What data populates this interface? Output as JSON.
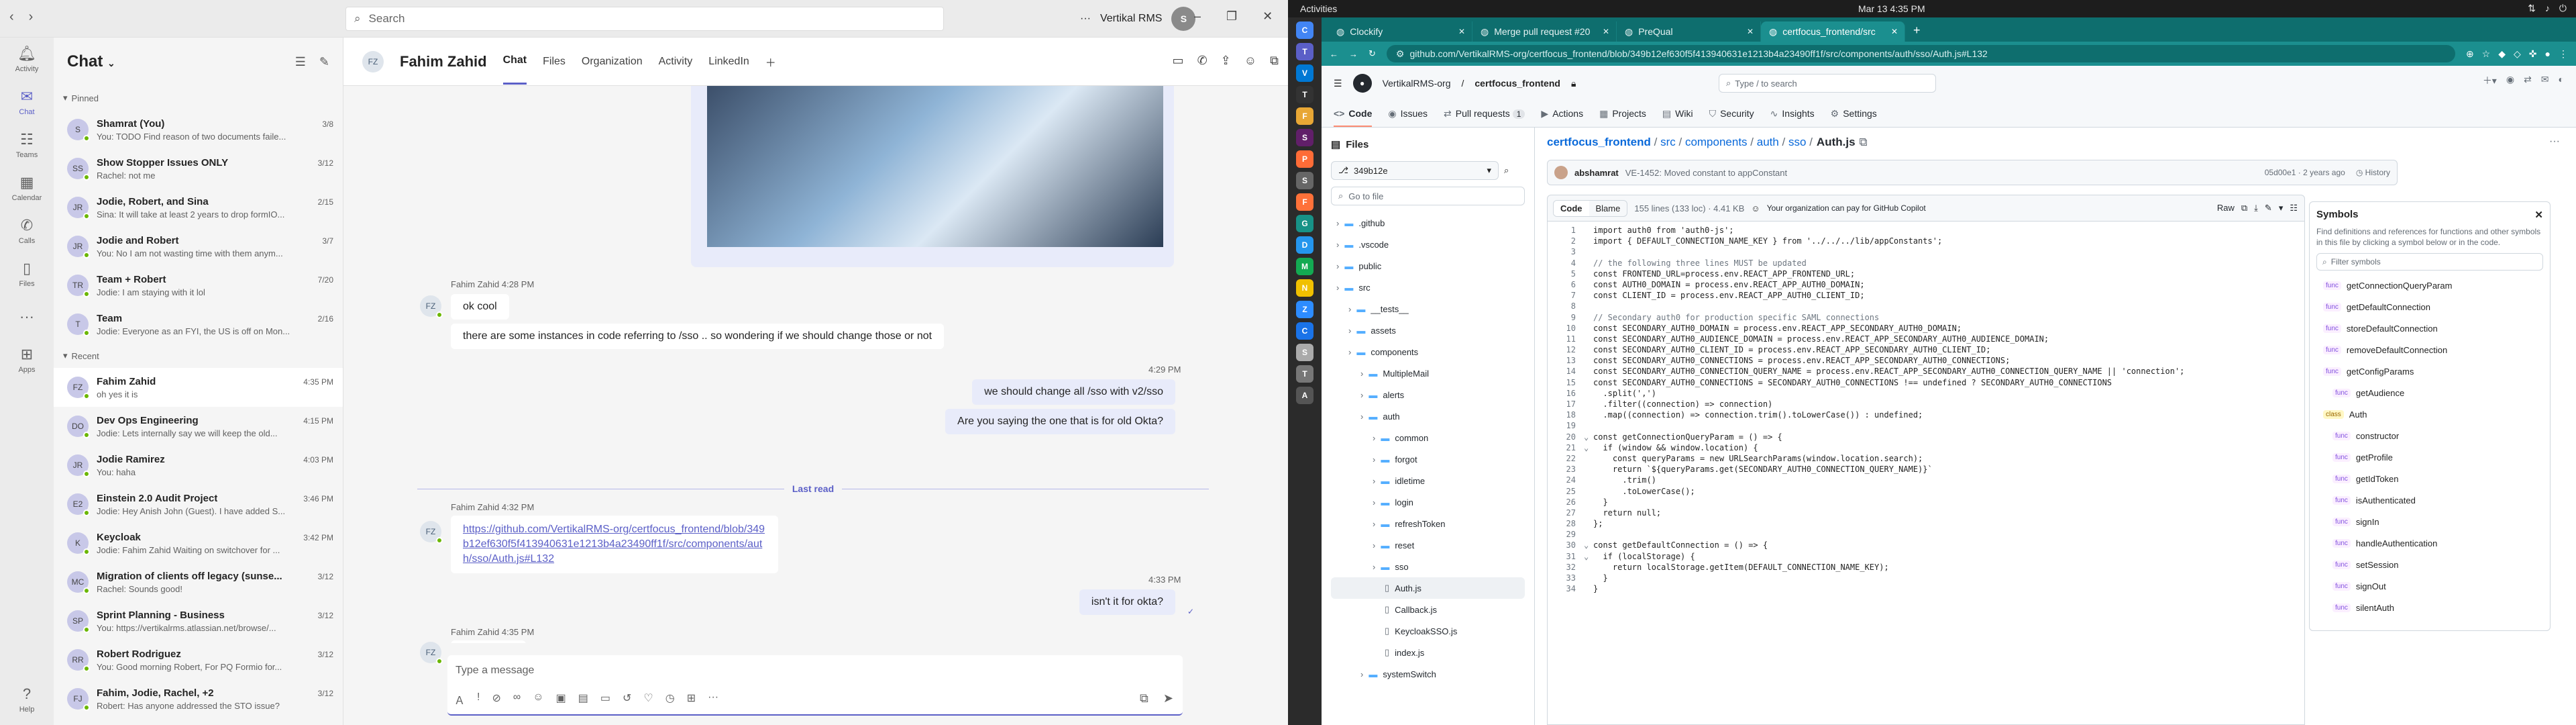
{
  "teams": {
    "search_placeholder": "Search",
    "org_name": "Vertikal RMS",
    "user_initials": "S",
    "rail": [
      {
        "label": "Activity",
        "icon": "bell-icon"
      },
      {
        "label": "Chat",
        "icon": "chat-icon"
      },
      {
        "label": "Teams",
        "icon": "teams-icon"
      },
      {
        "label": "Calendar",
        "icon": "calendar-icon"
      },
      {
        "label": "Calls",
        "icon": "phone-icon"
      },
      {
        "label": "Files",
        "icon": "file-icon"
      },
      {
        "label": "...",
        "icon": "more-icon"
      },
      {
        "label": "Apps",
        "icon": "apps-icon"
      },
      {
        "label": "Help",
        "icon": "help-icon"
      }
    ],
    "chatlist": {
      "title": "Chat",
      "pinned_label": "Pinned",
      "recent_label": "Recent",
      "pinned": [
        {
          "initials": "S",
          "name": "Shamrat (You)",
          "time": "3/8",
          "preview": "You: TODO Find reason of two documents faile..."
        },
        {
          "initials": "SS",
          "name": "Show Stopper Issues ONLY",
          "time": "3/12",
          "preview": "Rachel: not me"
        },
        {
          "initials": "JR",
          "name": "Jodie, Robert, and Sina",
          "time": "2/15",
          "preview": "Sina: It will take at least 2 years to drop formIO..."
        },
        {
          "initials": "JR",
          "name": "Jodie and Robert",
          "time": "3/7",
          "preview": "You: No I am not wasting time with them anym..."
        },
        {
          "initials": "TR",
          "name": "Team + Robert",
          "time": "7/20",
          "preview": "Jodie: I am staying with it lol"
        },
        {
          "initials": "T",
          "name": "Team",
          "time": "2/16",
          "preview": "Jodie: Everyone as an FYI, the US is off on Mon..."
        }
      ],
      "recent": [
        {
          "initials": "FZ",
          "name": "Fahim Zahid",
          "time": "4:35 PM",
          "preview": "oh yes it is"
        },
        {
          "initials": "DO",
          "name": "Dev Ops Engineering",
          "time": "4:15 PM",
          "preview": "Jodie: Lets internally say we will keep the old..."
        },
        {
          "initials": "JR",
          "name": "Jodie Ramirez",
          "time": "4:03 PM",
          "preview": "You: haha"
        },
        {
          "initials": "E2",
          "name": "Einstein 2.0 Audit Project",
          "time": "3:46 PM",
          "preview": "Jodie: Hey Anish John (Guest). I have added S..."
        },
        {
          "initials": "K",
          "name": "Keycloak",
          "time": "3:42 PM",
          "preview": "Jodie: Fahim Zahid Waiting on switchover for ..."
        },
        {
          "initials": "MC",
          "name": "Migration of clients off legacy (sunse...",
          "time": "3/12",
          "preview": "Rachel: Sounds good!"
        },
        {
          "initials": "SP",
          "name": "Sprint Planning - Business",
          "time": "3/12",
          "preview": "You: https://vertikalrms.atlassian.net/browse/..."
        },
        {
          "initials": "RR",
          "name": "Robert Rodriguez",
          "time": "3/12",
          "preview": "You: Good morning Robert, For PQ Formio for..."
        },
        {
          "initials": "FJ",
          "name": "Fahim, Jodie, Rachel, +2",
          "time": "3/12",
          "preview": "Robert: Has anyone addressed the STO issue?"
        }
      ]
    },
    "chat": {
      "contact_initials": "FZ",
      "contact_name": "Fahim Zahid",
      "tabs": [
        "Chat",
        "Files",
        "Organization",
        "Activity",
        "LinkedIn"
      ],
      "m1_meta": "Fahim Zahid   4:28 PM",
      "m1_a": "ok cool",
      "m1_b": "there are some instances in code referring to /sso .. so wondering if we should change those or not",
      "o1_time": "4:29 PM",
      "o1_a": "we should change all /sso with v2/sso",
      "o1_b": "Are you saying the one that is for old Okta?",
      "last_read": "Last read",
      "m2_meta": "Fahim Zahid   4:32 PM",
      "m2_link": "https://github.com/VertikalRMS-org/certfocus_frontend/blob/349b12ef630f5f413940631e1213b4a23490ff1f/src/components/auth/sso/Auth.js#L132",
      "o2_time": "4:33 PM",
      "o2_a": "isn't it for okta?",
      "m3_meta": "Fahim Zahid   4:35 PM",
      "m3_a": "oh yes it is",
      "compose_placeholder": "Type a message"
    }
  },
  "ubuntu": {
    "activities": "Activities",
    "clock": "Mar 13  4:35 PM"
  },
  "browser": {
    "tabs": [
      {
        "label": "Clockify",
        "active": false
      },
      {
        "label": "Merge pull request #20",
        "active": false
      },
      {
        "label": "PreQual",
        "active": false
      },
      {
        "label": "certfocus_frontend/src",
        "active": true
      }
    ],
    "url": "github.com/VertikalRMS-org/certfocus_frontend/blob/349b12ef630f5f413940631e1213b4a23490ff1f/src/components/auth/sso/Auth.js#L132"
  },
  "github": {
    "org": "VertikalRMS-org",
    "repo": "certfocus_frontend",
    "search_placeholder": "Type / to search",
    "tabs": [
      {
        "label": "Code",
        "count": ""
      },
      {
        "label": "Issues",
        "count": ""
      },
      {
        "label": "Pull requests",
        "count": "1"
      },
      {
        "label": "Actions",
        "count": ""
      },
      {
        "label": "Projects",
        "count": ""
      },
      {
        "label": "Wiki",
        "count": ""
      },
      {
        "label": "Security",
        "count": ""
      },
      {
        "label": "Insights",
        "count": ""
      },
      {
        "label": "Settings",
        "count": ""
      }
    ],
    "files_label": "Files",
    "branch": "349b12e",
    "goto_placeholder": "Go to file",
    "tree": [
      {
        "name": ".github",
        "depth": 0,
        "type": "dir"
      },
      {
        "name": ".vscode",
        "depth": 0,
        "type": "dir"
      },
      {
        "name": "public",
        "depth": 0,
        "type": "dir"
      },
      {
        "name": "src",
        "depth": 0,
        "type": "dir"
      },
      {
        "name": "__tests__",
        "depth": 1,
        "type": "dir"
      },
      {
        "name": "assets",
        "depth": 1,
        "type": "dir"
      },
      {
        "name": "components",
        "depth": 1,
        "type": "dir"
      },
      {
        "name": "MultipleMail",
        "depth": 2,
        "type": "dir"
      },
      {
        "name": "alerts",
        "depth": 2,
        "type": "dir"
      },
      {
        "name": "auth",
        "depth": 2,
        "type": "dir"
      },
      {
        "name": "common",
        "depth": 3,
        "type": "dir"
      },
      {
        "name": "forgot",
        "depth": 3,
        "type": "dir"
      },
      {
        "name": "idletime",
        "depth": 3,
        "type": "dir"
      },
      {
        "name": "login",
        "depth": 3,
        "type": "dir"
      },
      {
        "name": "refreshToken",
        "depth": 3,
        "type": "dir"
      },
      {
        "name": "reset",
        "depth": 3,
        "type": "dir"
      },
      {
        "name": "sso",
        "depth": 3,
        "type": "dir"
      },
      {
        "name": "Auth.js",
        "depth": 4,
        "type": "file"
      },
      {
        "name": "Callback.js",
        "depth": 4,
        "type": "file"
      },
      {
        "name": "KeycloakSSO.js",
        "depth": 4,
        "type": "file"
      },
      {
        "name": "index.js",
        "depth": 4,
        "type": "file"
      },
      {
        "name": "systemSwitch",
        "depth": 2,
        "type": "dir"
      }
    ],
    "breadcrumbs": [
      "certfocus_frontend",
      "src",
      "components",
      "auth",
      "sso"
    ],
    "filename": "Auth.js",
    "commit_author": "abshamrat",
    "commit_msg": "VE-1452: Moved constant to appConstant",
    "commit_hash": "05d00e1 · 2 years ago",
    "history": "History",
    "code_tab": "Code",
    "blame_tab": "Blame",
    "file_info": "155 lines (133 loc) · 4.41 KB",
    "copilot": "Your organization can pay for GitHub Copilot",
    "raw": "Raw",
    "code_lines": [
      "import auth0 from 'auth0-js';",
      "import { DEFAULT_CONNECTION_NAME_KEY } from '../../../lib/appConstants';",
      "",
      "// the following three lines MUST be updated",
      "const FRONTEND_URL=process.env.REACT_APP_FRONTEND_URL;",
      "const AUTH0_DOMAIN = process.env.REACT_APP_AUTH0_DOMAIN;",
      "const CLIENT_ID = process.env.REACT_APP_AUTH0_CLIENT_ID;",
      "",
      "// Secondary auth0 for production specific SAML connections",
      "const SECONDARY_AUTH0_DOMAIN = process.env.REACT_APP_SECONDARY_AUTH0_DOMAIN;",
      "const SECONDARY_AUTH0_AUDIENCE_DOMAIN = process.env.REACT_APP_SECONDARY_AUTH0_AUDIENCE_DOMAIN;",
      "const SECONDARY_AUTH0_CLIENT_ID = process.env.REACT_APP_SECONDARY_AUTH0_CLIENT_ID;",
      "const SECONDARY_AUTH0_CONNECTIONS = process.env.REACT_APP_SECONDARY_AUTH0_CONNECTIONS;",
      "const SECONDARY_AUTH0_CONNECTION_QUERY_NAME = process.env.REACT_APP_SECONDARY_AUTH0_CONNECTION_QUERY_NAME || 'connection';",
      "const SECONDARY_AUTH0_CONNECTIONS = SECONDARY_AUTH0_CONNECTIONS !== undefined ? SECONDARY_AUTH0_CONNECTIONS",
      "  .split(',')",
      "  .filter((connection) => connection)",
      "  .map((connection) => connection.trim().toLowerCase()) : undefined;",
      "",
      "const getConnectionQueryParam = () => {",
      "  if (window && window.location) {",
      "    const queryParams = new URLSearchParams(window.location.search);",
      "    return `${queryParams.get(SECONDARY_AUTH0_CONNECTION_QUERY_NAME)}`",
      "      .trim()",
      "      .toLowerCase();",
      "  }",
      "  return null;",
      "};",
      "",
      "const getDefaultConnection = () => {",
      "  if (localStorage) {",
      "    return localStorage.getItem(DEFAULT_CONNECTION_NAME_KEY);",
      "  }",
      "}"
    ],
    "symbols": {
      "title": "Symbols",
      "desc": "Find definitions and references for functions and other symbols in this file by clicking a symbol below or in the code.",
      "filter_placeholder": "Filter symbols",
      "items": [
        {
          "kind": "func",
          "name": "getConnectionQueryParam",
          "indent": 0
        },
        {
          "kind": "func",
          "name": "getDefaultConnection",
          "indent": 0
        },
        {
          "kind": "func",
          "name": "storeDefaultConnection",
          "indent": 0
        },
        {
          "kind": "func",
          "name": "removeDefaultConnection",
          "indent": 0
        },
        {
          "kind": "func",
          "name": "getConfigParams",
          "indent": 0
        },
        {
          "kind": "func",
          "name": "getAudience",
          "indent": 1
        },
        {
          "kind": "class",
          "name": "Auth",
          "indent": 0
        },
        {
          "kind": "func",
          "name": "constructor",
          "indent": 1
        },
        {
          "kind": "func",
          "name": "getProfile",
          "indent": 1
        },
        {
          "kind": "func",
          "name": "getIdToken",
          "indent": 1
        },
        {
          "kind": "func",
          "name": "isAuthenticated",
          "indent": 1
        },
        {
          "kind": "func",
          "name": "signIn",
          "indent": 1
        },
        {
          "kind": "func",
          "name": "handleAuthentication",
          "indent": 1
        },
        {
          "kind": "func",
          "name": "setSession",
          "indent": 1
        },
        {
          "kind": "func",
          "name": "signOut",
          "indent": 1
        },
        {
          "kind": "func",
          "name": "silentAuth",
          "indent": 1
        }
      ]
    }
  },
  "dock_icons": [
    "chrome",
    "teams",
    "vscode",
    "terminal",
    "files",
    "slack",
    "postman",
    "settings",
    "firefox",
    "gitkraken",
    "docker",
    "mongodb",
    "notes",
    "zoom",
    "chrome-dev",
    "screenshot",
    "trash",
    "apps"
  ]
}
